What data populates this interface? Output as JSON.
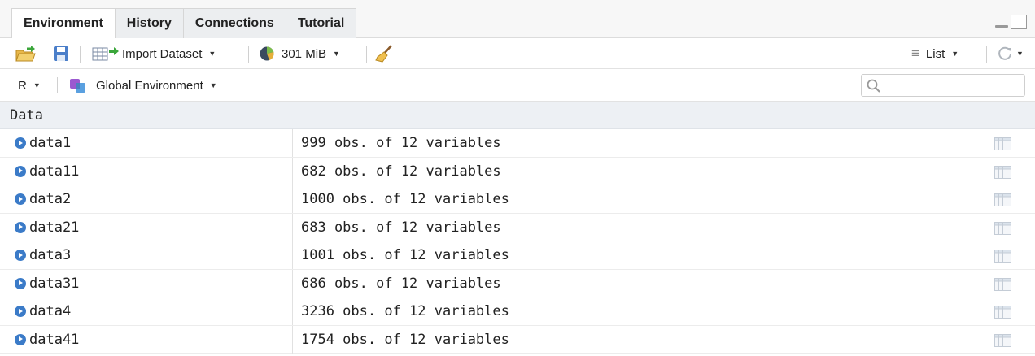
{
  "tabs": [
    {
      "label": "Environment",
      "active": true
    },
    {
      "label": "History",
      "active": false
    },
    {
      "label": "Connections",
      "active": false
    },
    {
      "label": "Tutorial",
      "active": false
    }
  ],
  "toolbar": {
    "import_dataset_label": "Import Dataset",
    "memory_label": "301 MiB",
    "view_mode_label": "List"
  },
  "envbar": {
    "language_label": "R",
    "environment_label": "Global Environment",
    "search_placeholder": ""
  },
  "section": {
    "title": "Data"
  },
  "rows": [
    {
      "name": "data1",
      "desc": "999 obs. of 12 variables"
    },
    {
      "name": "data11",
      "desc": "682 obs. of 12 variables"
    },
    {
      "name": "data2",
      "desc": "1000 obs. of 12 variables"
    },
    {
      "name": "data21",
      "desc": "683 obs. of 12 variables"
    },
    {
      "name": "data3",
      "desc": "1001 obs. of 12 variables"
    },
    {
      "name": "data31",
      "desc": "686 obs. of 12 variables"
    },
    {
      "name": "data4",
      "desc": "3236 obs. of 12 variables"
    },
    {
      "name": "data41",
      "desc": "1754 obs. of 12 variables"
    }
  ],
  "colors": {
    "accent": "#3b7bc8",
    "header_bg": "#edf0f4",
    "tab_bg": "#f7f7f7"
  }
}
